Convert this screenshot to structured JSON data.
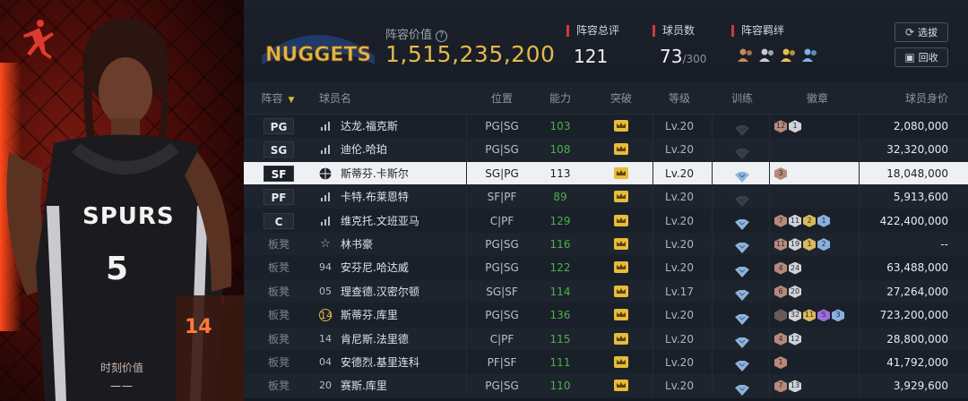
{
  "player_card": {
    "moment_value_label": "时刻价值",
    "moment_value": "——"
  },
  "header": {
    "team_logo_text": "NUGGETS",
    "lineup_value_label": "阵容价值",
    "lineup_value": "1,515,235,200",
    "stats": {
      "total_rating_label": "阵容总评",
      "total_rating_value": "121",
      "player_count_label": "球员数",
      "player_count_value": "73",
      "player_count_max": "/300",
      "synergy_label": "阵容羁绊"
    },
    "buttons": {
      "select_label": "选拔",
      "recycle_label": "回收"
    }
  },
  "table": {
    "headers": {
      "lineup": "阵容",
      "name": "球员名",
      "position": "位置",
      "ability": "能力",
      "breakthrough": "突破",
      "level": "等级",
      "training": "训练",
      "badges": "徽章",
      "price": "球员身价"
    },
    "rows": [
      {
        "slot": "PG",
        "jersey_icon": "signal-icon",
        "jersey": "",
        "name": "达龙.福克斯",
        "role": "PG|SG",
        "ability": "103",
        "level": "Lv.20",
        "badges": [
          {
            "v": "12",
            "c": "bronze"
          },
          {
            "v": "1",
            "c": "silver"
          }
        ],
        "price": "2,080,000"
      },
      {
        "slot": "SG",
        "jersey_icon": "signal-icon",
        "jersey": "",
        "name": "迪伦.哈珀",
        "role": "PG|SG",
        "ability": "108",
        "level": "Lv.20",
        "badges": [],
        "price": "32,320,000"
      },
      {
        "slot": "SF",
        "jersey_icon": "ball-icon",
        "jersey": "",
        "name": "斯蒂芬.卡斯尔",
        "role": "SG|PG",
        "ability": "113",
        "level": "Lv.20",
        "badges": [
          {
            "v": "3",
            "c": "bronze"
          }
        ],
        "price": "18,048,000",
        "selected": true
      },
      {
        "slot": "PF",
        "jersey_icon": "signal-icon",
        "jersey": "",
        "name": "卡特.布莱恩特",
        "role": "SF|PF",
        "ability": "89",
        "level": "Lv.20",
        "badges": [],
        "price": "5,913,600"
      },
      {
        "slot": "C",
        "jersey_icon": "signal-icon",
        "jersey": "",
        "name": "维克托.文班亚马",
        "role": "C|PF",
        "ability": "129",
        "level": "Lv.20",
        "badges": [
          {
            "v": "7",
            "c": "bronze"
          },
          {
            "v": "11",
            "c": "silver"
          },
          {
            "v": "2",
            "c": "gold"
          },
          {
            "v": "1",
            "c": "blue"
          }
        ],
        "price": "422,400,000"
      },
      {
        "slot": "板凳",
        "jersey_icon": "star-icon",
        "jersey": "",
        "name": "林书豪",
        "role": "PG|SG",
        "ability": "116",
        "level": "Lv.20",
        "badges": [
          {
            "v": "11",
            "c": "bronze"
          },
          {
            "v": "19",
            "c": "silver"
          },
          {
            "v": "1",
            "c": "gold"
          },
          {
            "v": "2",
            "c": "blue"
          }
        ],
        "price": "--"
      },
      {
        "slot": "板凳",
        "jersey_icon": "",
        "jersey": "94",
        "name": "安芬尼.哈达威",
        "role": "PG|SG",
        "ability": "122",
        "level": "Lv.20",
        "badges": [
          {
            "v": "4",
            "c": "bronze"
          },
          {
            "v": "24",
            "c": "silver"
          }
        ],
        "price": "63,488,000"
      },
      {
        "slot": "板凳",
        "jersey_icon": "",
        "jersey": "05",
        "name": "理查德.汉密尔顿",
        "role": "SG|SF",
        "ability": "114",
        "level": "Lv.17",
        "badges": [
          {
            "v": "6",
            "c": "bronze"
          },
          {
            "v": "20",
            "c": "silver"
          }
        ],
        "price": "27,264,000"
      },
      {
        "slot": "板凳",
        "jersey_icon": "",
        "jersey": "14",
        "name": "斯蒂芬.库里",
        "role": "PG|SG",
        "ability": "136",
        "level": "Lv.20",
        "badges": [
          {
            "v": "",
            "c": "dark"
          },
          {
            "v": "32",
            "c": "silver"
          },
          {
            "v": "11",
            "c": "gold"
          },
          {
            "v": "5",
            "c": "purple"
          },
          {
            "v": "3",
            "c": "blue"
          }
        ],
        "price": "723,200,000"
      },
      {
        "slot": "板凳",
        "jersey_icon": "",
        "jersey": "14",
        "name": "肯尼斯.法里德",
        "role": "C|PF",
        "ability": "115",
        "level": "Lv.20",
        "badges": [
          {
            "v": "4",
            "c": "bronze"
          },
          {
            "v": "12",
            "c": "silver"
          }
        ],
        "price": "28,800,000"
      },
      {
        "slot": "板凳",
        "jersey_icon": "",
        "jersey": "04",
        "name": "安德烈.基里连科",
        "role": "PF|SF",
        "ability": "111",
        "level": "Lv.20",
        "badges": [
          {
            "v": "1",
            "c": "bronze"
          }
        ],
        "price": "41,792,000"
      },
      {
        "slot": "板凳",
        "jersey_icon": "",
        "jersey": "20",
        "name": "赛斯.库里",
        "role": "PG|SG",
        "ability": "110",
        "level": "Lv.20",
        "badges": [
          {
            "v": "7",
            "c": "bronze"
          },
          {
            "v": "13",
            "c": "silver"
          }
        ],
        "price": "3,929,600"
      }
    ]
  },
  "colors": {
    "accent_gold": "#e5b94a",
    "ability_green": "#4bb04a",
    "stat_marker_red": "#d03a3a"
  }
}
